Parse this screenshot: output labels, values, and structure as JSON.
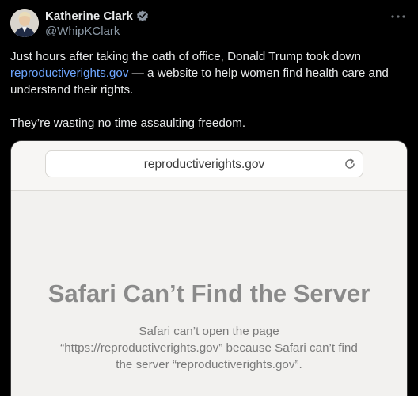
{
  "author": {
    "name": "Katherine Clark",
    "handle": "@WhipKClark"
  },
  "icons": {
    "verified": "verified-badge-icon",
    "more": "more-options-icon",
    "reload": "reload-icon"
  },
  "colors": {
    "background": "#000000",
    "link": "#6ea6ff",
    "handle": "#8b98a5"
  },
  "post": {
    "line1": "Just hours after taking the oath of office, Donald Trump took down",
    "link_text": "reproductiverights.gov",
    "line2_rest": " — a website to help women find health care and understand their rights.",
    "line3": "They’re wasting no time assaulting freedom."
  },
  "media": {
    "url": "reproductiverights.gov",
    "error_title": "Safari Can’t Find the Server",
    "error_message": "Safari can’t open the page “https://reproductiverights.gov” because Safari can’t find the server “reproductiverights.gov”."
  }
}
